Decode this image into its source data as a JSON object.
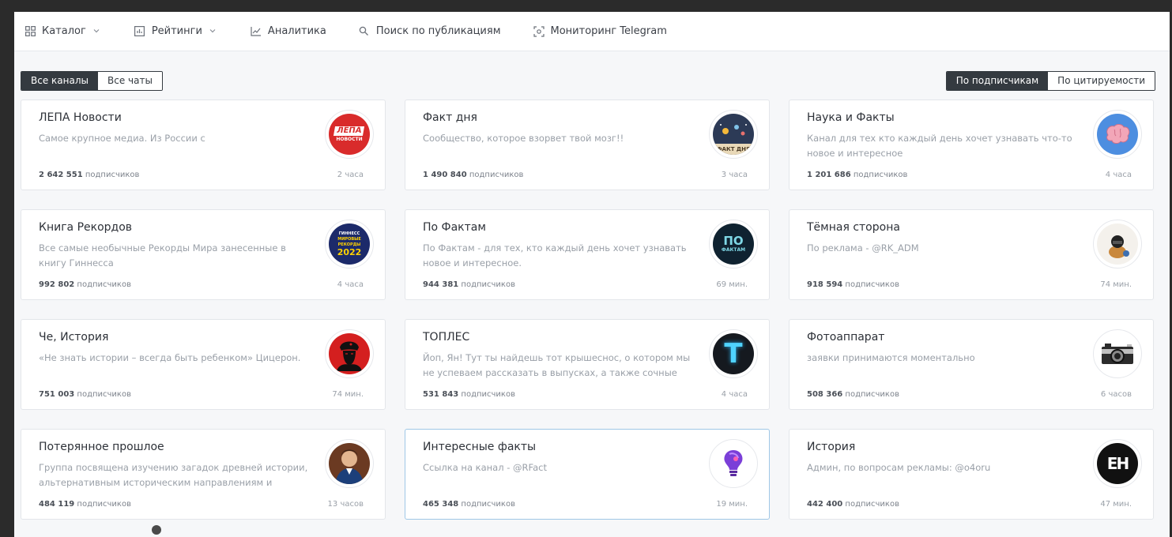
{
  "nav": {
    "items": [
      {
        "label": "Каталог",
        "icon": "grid-icon",
        "has_dropdown": true
      },
      {
        "label": "Рейтинги",
        "icon": "ratings-icon",
        "has_dropdown": true
      },
      {
        "label": "Аналитика",
        "icon": "chart-line-icon",
        "has_dropdown": false
      },
      {
        "label": "Поиск по публикациям",
        "icon": "search-icon",
        "has_dropdown": false
      },
      {
        "label": "Мониторинг Telegram",
        "icon": "monitor-icon",
        "has_dropdown": false
      }
    ]
  },
  "filter": {
    "all_channels": "Все каналы",
    "all_chats": "Все чаты",
    "active": "all_channels"
  },
  "sort": {
    "by_subscribers": "По подписчикам",
    "by_citation": "По цитируемости",
    "active": "by_subscribers"
  },
  "subs_suffix": "подписчиков",
  "cards": [
    {
      "title": "ЛЕПА Новости",
      "desc": "Самое крупное медиа. Из России с",
      "subs": "2 642 551",
      "time": "2 часа",
      "avatar": "lepa-logo"
    },
    {
      "title": "Факт дня",
      "desc": "Сообщество, которое взорвет твой мозг!!",
      "subs": "1 490 840",
      "time": "3 часа",
      "avatar": "fakt-dnya-logo"
    },
    {
      "title": "Наука и Факты",
      "desc": "Канал для тех кто каждый день хочет узнавать что-то новое и интересное",
      "subs": "1 201 686",
      "time": "4 часа",
      "avatar": "brain-logo"
    },
    {
      "title": "Книга Рекордов",
      "desc": "Все самые необычные Рекорды Мира занесенные в книгу Гиннесса",
      "subs": "992 802",
      "time": "4 часа",
      "avatar": "guinness-logo"
    },
    {
      "title": "По Фактам",
      "desc": "По Фактам - для тех, кто каждый день хочет узнавать новое и интересное.",
      "subs": "944 381",
      "time": "69 мин.",
      "avatar": "po-faktam-logo"
    },
    {
      "title": "Тёмная сторона",
      "desc": "По реклама - @RK_ADM",
      "subs": "918 594",
      "time": "74 мин.",
      "avatar": "dark-side-logo"
    },
    {
      "title": "Че, История",
      "desc": "«Не знать истории – всегда быть ребенком» Цицерон.",
      "subs": "751 003",
      "time": "74 мин.",
      "avatar": "che-logo"
    },
    {
      "title": "ТОПЛЕС",
      "desc": "Йоп, Ян! Тут ты найдешь тот крышеснос, о котором мы не успеваем рассказать в выпусках, а также сочные истори...",
      "subs": "531 843",
      "time": "4 часа",
      "avatar": "toples-logo"
    },
    {
      "title": "Фотоаппарат",
      "desc": "заявки принимаются моментально",
      "subs": "508 366",
      "time": "6 часов",
      "avatar": "camera-logo"
    },
    {
      "title": "Потерянное прошлое",
      "desc": "Группа посвящена изучению загадок древней истории, альтернативным историческим направлениям и тайнам...",
      "subs": "484 119",
      "time": "13 часов",
      "avatar": "portrait-logo"
    },
    {
      "title": "Интересные факты",
      "desc": "Ссылка на канал - @RFact",
      "subs": "465 348",
      "time": "19 мин.",
      "avatar": "bulb-logo"
    },
    {
      "title": "История",
      "desc": "Админ, по вопросам рекламы: @o4oru",
      "subs": "442 400",
      "time": "47 мин.",
      "avatar": "history-logo"
    }
  ],
  "avatar_text": {
    "lepa_line1": "ЛЕПА",
    "lepa_line2": "НОВОСТИ",
    "fakt": "ФАКТ ДНЯ",
    "guinness_line1": "ГИННЕСС",
    "guinness_line2": "МИРОВЫЕ",
    "guinness_line3": "РЕКОРДЫ",
    "guinness_line4": "2022",
    "pofaktam_line1": "ПО",
    "pofaktam_line2": "ФАКТАМ",
    "toples": "T",
    "history": "ЕН"
  }
}
